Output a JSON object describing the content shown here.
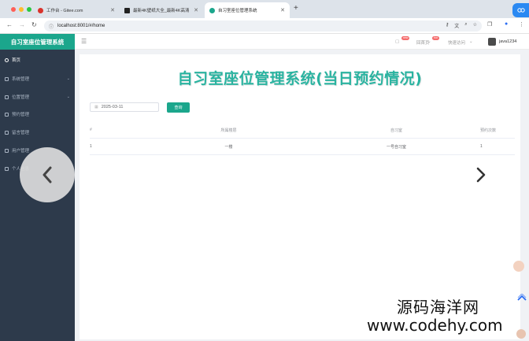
{
  "browser": {
    "tabs": [
      {
        "title": "工作台 - Gitee.com",
        "fav_color": "#d9332b"
      },
      {
        "title": "最新4K壁纸大全_最新4K高清壁纸...",
        "fav_color": "#222222"
      },
      {
        "title": "自习室座位管理系统",
        "fav_color": "#1ba68c"
      }
    ],
    "new_tab": "+",
    "url": "localhost:8001/#/home"
  },
  "header": {
    "logo": "自习室座位管理系统",
    "badge_new": "new",
    "nav_home": "回首页",
    "badge_hot": "hot",
    "quick_access": "快速访问",
    "username": "java1234"
  },
  "sidebar": {
    "items": [
      {
        "label": "首页",
        "active": true,
        "has_arrow": false
      },
      {
        "label": "系统管理",
        "active": false,
        "has_arrow": true
      },
      {
        "label": "位置管理",
        "active": false,
        "has_arrow": true
      },
      {
        "label": "预约管理",
        "active": false,
        "has_arrow": false
      },
      {
        "label": "留言管理",
        "active": false,
        "has_arrow": false
      },
      {
        "label": "用户管理",
        "active": false,
        "has_arrow": false
      },
      {
        "label": "个人信息",
        "active": false,
        "has_arrow": false
      }
    ]
  },
  "main": {
    "title": "自习室座位管理系统(当日预约情况)",
    "date_value": "2025-03-11",
    "query_label": "查询",
    "table": {
      "headers": [
        "#",
        "所属楼层",
        "自习室",
        "预约次数"
      ],
      "rows": [
        [
          "1",
          "一楼",
          "一号自习室",
          "1"
        ]
      ]
    }
  },
  "watermark": {
    "cn": "源码海洋网",
    "url": "www.codehy.com"
  },
  "colors": {
    "accent": "#1ba68c",
    "title": "#2ab3a0",
    "sidebar": "#2d3a4b"
  }
}
